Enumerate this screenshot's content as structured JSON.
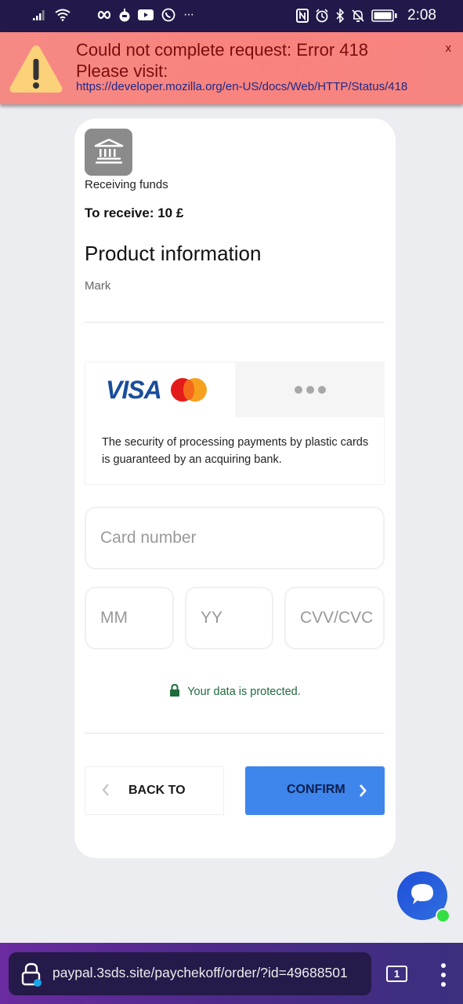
{
  "status_bar": {
    "time": "2:08",
    "left_icons": [
      "signal-icon",
      "wifi-icon",
      "infinity-icon",
      "game-icon",
      "youtube-icon",
      "whatsapp-icon",
      "more-notifications-icon"
    ],
    "right_icons": [
      "nfc-icon",
      "alarm-icon",
      "bluetooth-icon",
      "silent-icon",
      "battery-icon"
    ],
    "more_glyph": "···"
  },
  "error_banner": {
    "title": "Could not complete request: Error 418",
    "subtitle": "Please visit:",
    "link": "https://developer.mozilla.org/en-US/docs/Web/HTTP/Status/418",
    "close_label": "x",
    "icon": "warning-icon",
    "colors": {
      "background": "#f78783",
      "text": "#7a0d0d",
      "link": "#1e2a8a"
    }
  },
  "merchant": {
    "icon": "bank-icon",
    "label": "Receiving funds",
    "amount_text": "To receive: 10 £"
  },
  "product": {
    "heading": "Product information",
    "name": "Mark"
  },
  "payment_methods": {
    "tabs": [
      {
        "id": "cards",
        "label": "VISA",
        "selected": true
      },
      {
        "id": "other",
        "label": "•••",
        "selected": false
      }
    ],
    "description": "The security of processing payments by plastic cards is guaranteed by an acquiring bank."
  },
  "form": {
    "card_number_placeholder": "Card number",
    "month_placeholder": "MM",
    "year_placeholder": "YY",
    "cvv_placeholder": "CVV/CVC",
    "protected_text": "Your data is protected."
  },
  "actions": {
    "back_label": "BACK TO",
    "confirm_label": "CONFIRM",
    "colors": {
      "confirm_bg": "#3e85ec",
      "protected_text": "#1e6b3c"
    }
  },
  "chat": {
    "icon": "chat-icon",
    "online": true
  },
  "browser": {
    "url": "paypal.3sds.site/paychekoff/order/?id=49688501",
    "tab_count": "1"
  }
}
